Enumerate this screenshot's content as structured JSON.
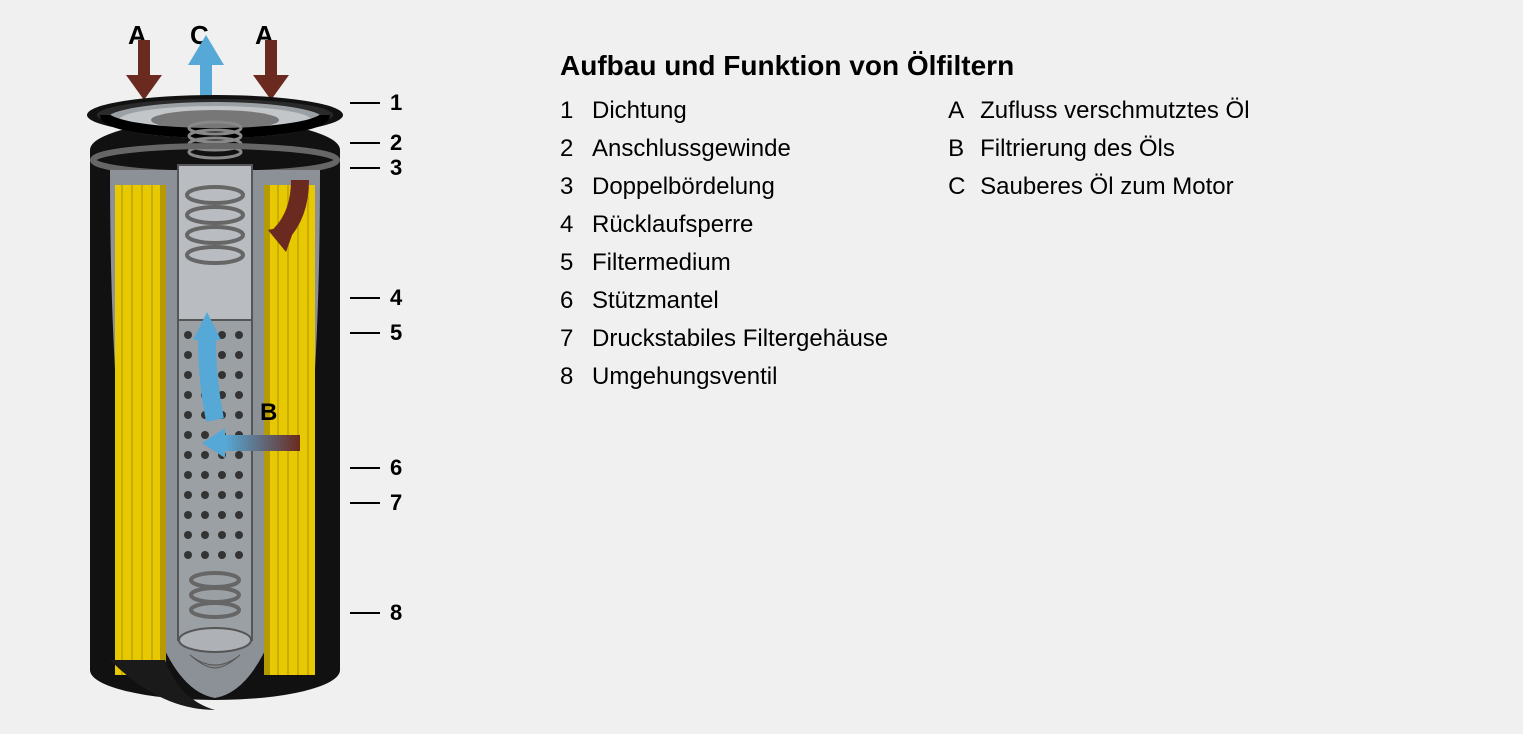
{
  "title": "Aufbau und Funktion von Ölfiltern",
  "toplabels": {
    "A1": "A",
    "C": "C",
    "A2": "A"
  },
  "numbers": {
    "1": "1",
    "2": "2",
    "3": "3",
    "4": "4",
    "5": "5",
    "6": "6",
    "7": "7",
    "8": "8",
    "B": "B"
  },
  "legend_numbers": [
    {
      "k": "1",
      "v": "Dichtung"
    },
    {
      "k": "2",
      "v": "Anschlussgewinde"
    },
    {
      "k": "3",
      "v": "Doppelbördelung"
    },
    {
      "k": "4",
      "v": "Rücklaufsperre"
    },
    {
      "k": "5",
      "v": "Filtermedium"
    },
    {
      "k": "6",
      "v": "Stützmantel"
    },
    {
      "k": "7",
      "v": "Druckstabiles Filtergehäuse"
    },
    {
      "k": "8",
      "v": "Umgehungsventil"
    }
  ],
  "legend_letters": [
    {
      "k": "A",
      "v": "Zufluss verschmutztes Öl"
    },
    {
      "k": "B",
      "v": "Filtrierung des Öls"
    },
    {
      "k": "C",
      "v": "Sauberes Öl zum Motor"
    }
  ]
}
